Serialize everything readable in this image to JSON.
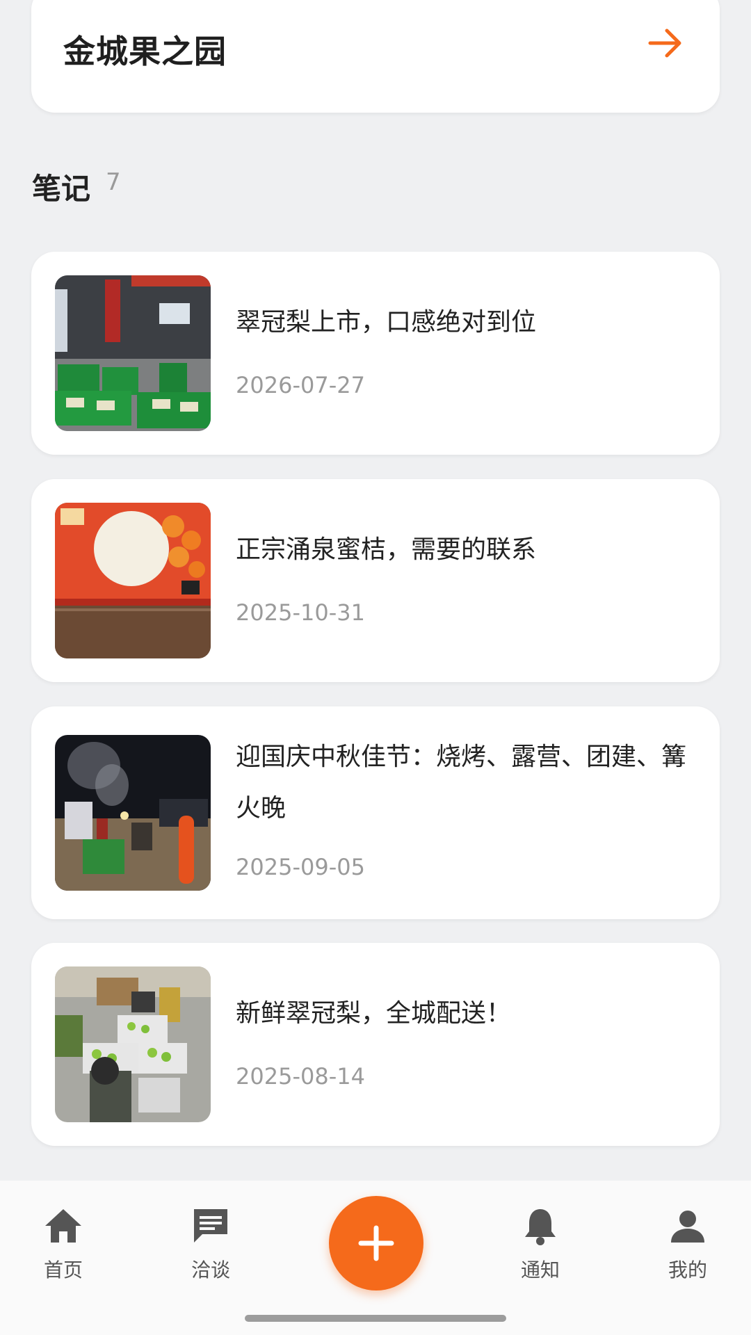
{
  "shop": {
    "name": "金城果之园",
    "arrow_icon": "arrow-right-icon",
    "accent_color": "#f56a1b"
  },
  "notes_section": {
    "title": "笔记",
    "count": "7"
  },
  "notes": [
    {
      "title": "翠冠梨上市，口感绝对到位",
      "date": "2026-07-27",
      "thumb": "pear-boxes-storefront-photo"
    },
    {
      "title": "正宗涌泉蜜桔，需要的联系",
      "date": "2025-10-31",
      "thumb": "tangerine-gift-box-photo"
    },
    {
      "title": "迎国庆中秋佳节：烧烤、露营、团建、篝火晚",
      "date": "2025-09-05",
      "thumb": "night-bbq-camp-photo"
    },
    {
      "title": "新鲜翠冠梨，全城配送！",
      "date": "2025-08-14",
      "thumb": "pear-sorting-photo"
    }
  ],
  "tabbar": {
    "items": [
      {
        "label": "首页",
        "icon": "home-icon"
      },
      {
        "label": "洽谈",
        "icon": "chat-icon"
      },
      {
        "label": "通知",
        "icon": "bell-icon"
      },
      {
        "label": "我的",
        "icon": "user-icon"
      }
    ],
    "fab_icon": "plus-icon"
  }
}
